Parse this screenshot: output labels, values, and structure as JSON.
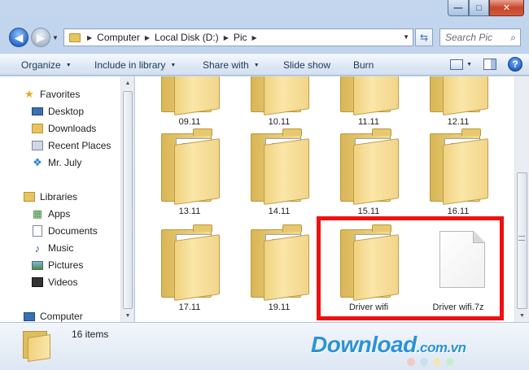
{
  "window": {
    "controls": {
      "minimize": "—",
      "maximize": "□",
      "close": "✕"
    }
  },
  "address": {
    "segments": [
      "Computer",
      "Local Disk (D:)",
      "Pic"
    ],
    "search_placeholder": "Search Pic"
  },
  "toolbar": {
    "organize": "Organize",
    "include_in_library": "Include in library",
    "share_with": "Share with",
    "slide_show": "Slide show",
    "burn": "Burn",
    "help": "?"
  },
  "navpane": {
    "favorites": {
      "label": "Favorites",
      "items": [
        "Desktop",
        "Downloads",
        "Recent Places",
        "Mr. July"
      ]
    },
    "libraries": {
      "label": "Libraries",
      "items": [
        "Apps",
        "Documents",
        "Music",
        "Pictures",
        "Videos"
      ]
    },
    "computer": {
      "label": "Computer"
    }
  },
  "files": [
    {
      "name": "09.11",
      "kind": "folder"
    },
    {
      "name": "10.11",
      "kind": "folder"
    },
    {
      "name": "11.11",
      "kind": "folder"
    },
    {
      "name": "12.11",
      "kind": "folder"
    },
    {
      "name": "13.11",
      "kind": "folder"
    },
    {
      "name": "14.11",
      "kind": "folder"
    },
    {
      "name": "15.11",
      "kind": "folder"
    },
    {
      "name": "16.11",
      "kind": "folder"
    },
    {
      "name": "17.11",
      "kind": "folder"
    },
    {
      "name": "19.11",
      "kind": "folder"
    },
    {
      "name": "Driver wifi",
      "kind": "folder"
    },
    {
      "name": "Driver wifi.7z",
      "kind": "file"
    }
  ],
  "details": {
    "count": "16 items"
  },
  "watermark": {
    "brand": "Download",
    "domain": ".com.vn"
  },
  "colors": {
    "highlight": "#ee1111",
    "accent": "#2a93d6",
    "folder": "#f0d27e"
  }
}
